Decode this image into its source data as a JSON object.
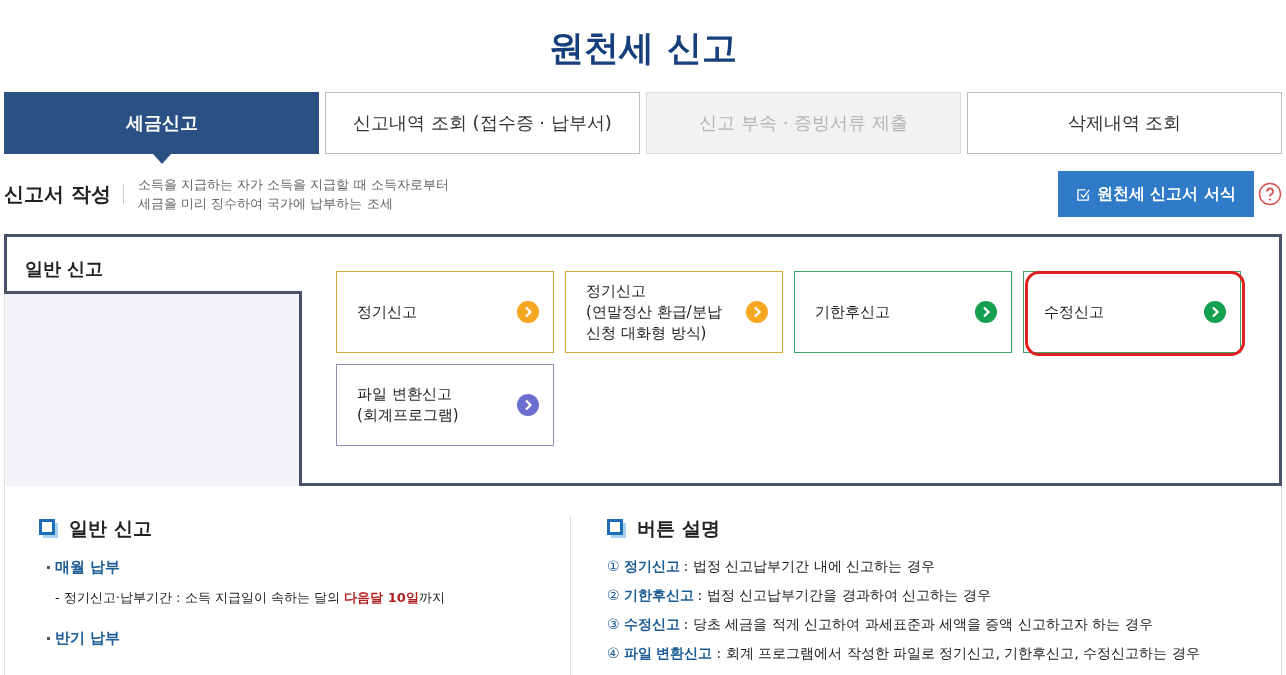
{
  "page_title": "원천세 신고",
  "tabs": [
    {
      "label": "세금신고",
      "selected": true,
      "disabled": false
    },
    {
      "label": "신고내역 조회 (접수증 · 납부서)",
      "selected": false,
      "disabled": false
    },
    {
      "label": "신고 부속 · 증빙서류 제출",
      "selected": false,
      "disabled": true
    },
    {
      "label": "삭제내역 조회",
      "selected": false,
      "disabled": false
    }
  ],
  "section": {
    "title": "신고서 작성",
    "description": [
      "소득을 지급하는 자가 소득을 지급할 때 소득자로부터",
      "세금을 미리 징수하여 국가에 납부하는 조세"
    ],
    "form_button": "원천세 신고서 서식"
  },
  "panel": {
    "tab_label": "일반 신고",
    "cards": [
      {
        "lines": [
          "정기신고"
        ],
        "color": "#f5a623",
        "highlighted": false
      },
      {
        "lines": [
          "정기신고",
          "(연말정산 환급/분납",
          "신청 대화형 방식)"
        ],
        "color": "#f5a623",
        "highlighted": false
      },
      {
        "lines": [
          "기한후신고"
        ],
        "color": "#14a050",
        "highlighted": false
      },
      {
        "lines": [
          "수정신고"
        ],
        "color": "#14a050",
        "highlighted": true
      },
      {
        "lines": [
          "파일 변환신고",
          "(회계프로그램)"
        ],
        "color": "#6a6fcf",
        "highlighted": false
      }
    ]
  },
  "info": {
    "left": {
      "title": "일반 신고",
      "groups": [
        {
          "heading": "매월 납부",
          "notes": [
            "- 정기신고·납부기간 : 소득 지급일이 속하는 달의 **다음달 10일**까지"
          ]
        },
        {
          "heading": "반기 납부"
        }
      ]
    },
    "right": {
      "title": "버튼 설명",
      "items": [
        {
          "number": "①",
          "term": "정기신고",
          "description": ": 법정 신고납부기간 내에 신고하는 경우"
        },
        {
          "number": "②",
          "term": "기한후신고",
          "description": ": 법정 신고납부기간을 경과하여 신고하는 경우"
        },
        {
          "number": "③",
          "term": "수정신고",
          "description": ": 당초 세금을 적게 신고하여 과세표준과 세액을 증액 신고하고자 하는 경우"
        },
        {
          "number": "④",
          "term": "파일 변환신고",
          "description": ": 회계 프로그램에서 작성한 파일로 정기신고, 기한후신고, 수정신고하는 경우"
        }
      ]
    }
  }
}
